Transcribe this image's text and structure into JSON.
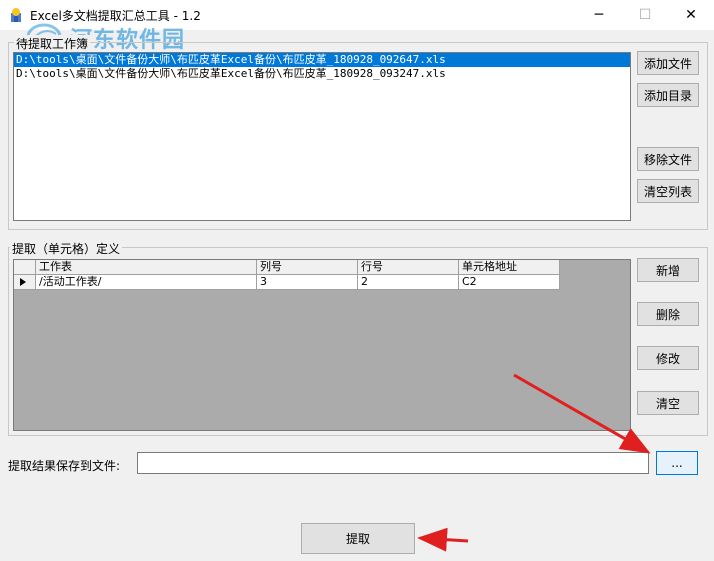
{
  "window": {
    "title": "Excel多文档提取汇总工具 - 1.2",
    "minimize_glyph": "─",
    "maximize_glyph": "☐",
    "close_glyph": "✕"
  },
  "watermark": {
    "text": "河东软件园"
  },
  "workbooks_group": {
    "title": "待提取工作簿",
    "files": [
      "D:\\tools\\桌面\\文件备份大师\\布匹皮革Excel备份\\布匹皮革_180928_092647.xls",
      "D:\\tools\\桌面\\文件备份大师\\布匹皮革Excel备份\\布匹皮革_180928_093247.xls"
    ],
    "selected_index": 0,
    "buttons": {
      "add_file": "添加文件",
      "add_dir": "添加目录",
      "remove_file": "移除文件",
      "clear_list": "清空列表"
    }
  },
  "define_group": {
    "title": "提取（单元格）定义",
    "columns": [
      "工作表",
      "列号",
      "行号",
      "单元格地址"
    ],
    "rows": [
      [
        "/活动工作表/",
        "3",
        "2",
        "C2"
      ]
    ],
    "buttons": {
      "add": "新增",
      "delete": "删除",
      "edit": "修改",
      "clear": "清空"
    }
  },
  "save": {
    "label": "提取结果保存到文件:",
    "value": "",
    "browse_label": "...",
    "extract_label": "提取"
  },
  "colors": {
    "selection": "#0078d7",
    "arrow": "#e02020",
    "window_bg": "#f0f0f0"
  }
}
